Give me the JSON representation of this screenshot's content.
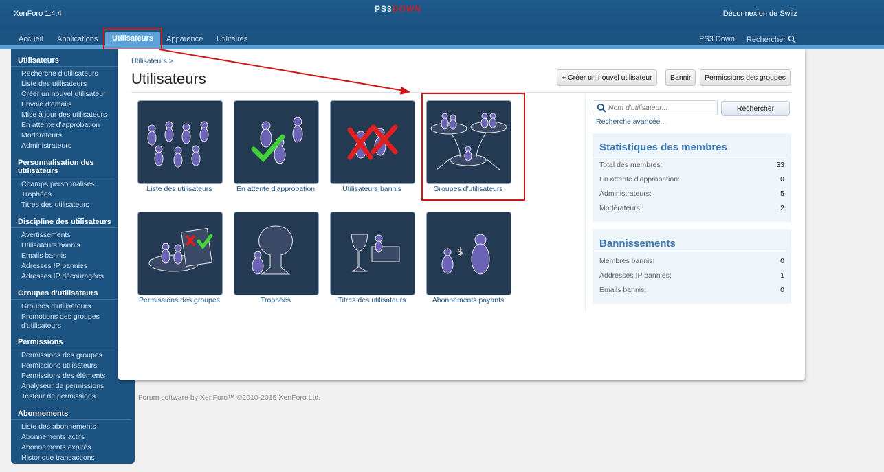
{
  "topbar": {
    "version": "XenForo 1.4.4",
    "logo_left": "PS3",
    "logo_right": "DOWN",
    "logout": "Déconnexion de Swiiz"
  },
  "nav": {
    "tabs": [
      "Accueil",
      "Applications",
      "Utilisateurs",
      "Apparence",
      "Utilitaires"
    ],
    "right": [
      "PS3 Down",
      "Rechercher"
    ]
  },
  "sidebar": {
    "sections": [
      {
        "title": "Utilisateurs",
        "items": [
          "Recherche d'utilisateurs",
          "Liste des utilisateurs",
          "Créer un nouvel utilisateur",
          "Envoie d'emails",
          "Mise à jour des utilisateurs",
          "En attente d'approbation",
          "Modérateurs",
          "Administrateurs"
        ]
      },
      {
        "title": "Personnalisation des utilisateurs",
        "items": [
          "Champs personnalisés",
          "Trophées",
          "Titres des utilisateurs"
        ]
      },
      {
        "title": "Discipline des utilisateurs",
        "items": [
          "Avertissements",
          "Utilisateurs bannis",
          "Emails bannis",
          "Adresses IP bannies",
          "Adresses IP découragées"
        ]
      },
      {
        "title": "Groupes d'utilisateurs",
        "items": [
          "Groupes d'utilisateurs",
          "Promotions des groupes d'utilisateurs"
        ]
      },
      {
        "title": "Permissions",
        "items": [
          "Permissions des groupes",
          "Permissions utilisateurs",
          "Permissions des éléments",
          "Analyseur de permissions",
          "Testeur de permissions"
        ]
      },
      {
        "title": "Abonnements",
        "items": [
          "Liste des abonnements",
          "Abonnements actifs",
          "Abonnements expirés",
          "Historique transactions"
        ]
      }
    ]
  },
  "main": {
    "breadcrumb": "Utilisateurs >",
    "title": "Utilisateurs",
    "buttons": [
      "+ Créer un nouvel utilisateur",
      "Bannir",
      "Permissions des groupes"
    ],
    "tiles": [
      "Liste des utilisateurs",
      "En attente d'approbation",
      "Utilisateurs bannis",
      "Groupes d'utilisateurs",
      "Permissions des groupes",
      "Trophées",
      "Titres des utilisateurs",
      "Abonnements payants"
    ]
  },
  "search": {
    "placeholder": "Nom d'utilisateur...",
    "button": "Rechercher",
    "advanced": "Recherche avancée..."
  },
  "stats": {
    "title": "Statistiques des membres",
    "rows": [
      {
        "label": "Total des membres:",
        "value": "33"
      },
      {
        "label": "En attente d'approbation:",
        "value": "0"
      },
      {
        "label": "Administrateurs:",
        "value": "5"
      },
      {
        "label": "Modérateurs:",
        "value": "2"
      }
    ]
  },
  "bans": {
    "title": "Bannissements",
    "rows": [
      {
        "label": "Membres bannis:",
        "value": "0"
      },
      {
        "label": "Addresses IP bannies:",
        "value": "1"
      },
      {
        "label": "Emails bannis:",
        "value": "0"
      }
    ]
  },
  "footer": "Forum software by XenForo™ ©2010-2015 XenForo Ltd.",
  "colors": {
    "header": "#1f5b8c",
    "accent": "#5fa2d8",
    "highlight": "#d11616",
    "tile": "#233a52"
  }
}
